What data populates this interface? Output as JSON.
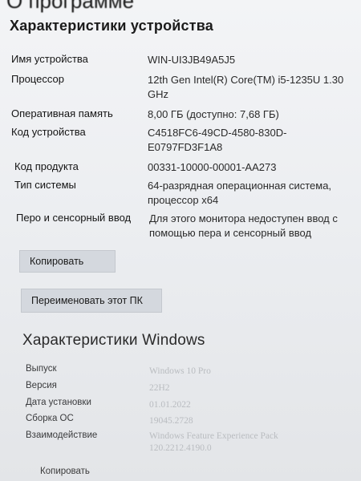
{
  "page_title": "О программе",
  "device": {
    "heading": "Характеристики устройства",
    "rows": [
      {
        "label": "Имя устройства",
        "value": "WIN-UI3JB49A5J5"
      },
      {
        "label": "Процессор",
        "value": "12th Gen Intel(R) Core(TM) i5-1235U   1.30 GHz"
      },
      {
        "label": "Оперативная память",
        "value": "8,00 ГБ (доступно: 7,68 ГБ)"
      },
      {
        "label": "Код устройства",
        "value": "C4518FC6-49CD-4580-830D-E0797FD3F1A8"
      },
      {
        "label": "Код продукта",
        "value": "00331-10000-00001-AA273"
      },
      {
        "label": "Тип системы",
        "value": "64-разрядная операционная система, процессор x64"
      },
      {
        "label": "Перо и сенсорный ввод",
        "value": "Для этого монитора недоступен ввод с помощью пера и сенсорный ввод"
      }
    ],
    "copy_label": "Копировать",
    "rename_label": "Переименовать этот ПК"
  },
  "windows": {
    "heading": "Характеристики Windows",
    "rows": [
      {
        "label": "Выпуск",
        "value": "Windows 10 Pro"
      },
      {
        "label": "Версия",
        "value": "22H2"
      },
      {
        "label": "Дата установки",
        "value": "01.01.2022"
      },
      {
        "label": "Сборка ОС",
        "value": "19045.2728"
      },
      {
        "label": "Взаимодействие",
        "value": "Windows Feature Experience Pack 120.2212.4190.0"
      }
    ],
    "copy_label": "Копировать"
  }
}
